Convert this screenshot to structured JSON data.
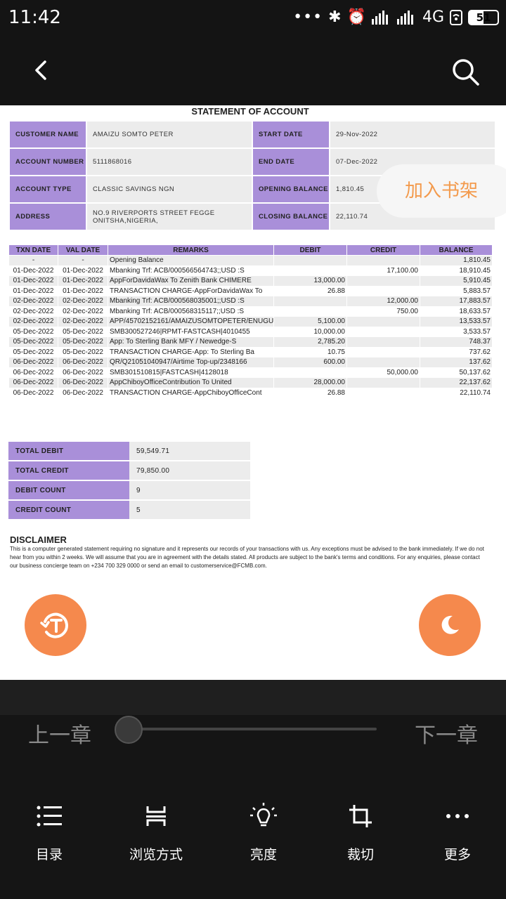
{
  "status_bar": {
    "time": "11:42",
    "network": "4G",
    "battery": "51",
    "icons": [
      "more-dots-icon",
      "bluetooth-icon",
      "alarm-icon",
      "signal-icon",
      "signal-icon",
      "wifi-hotspot-icon",
      "battery-icon"
    ]
  },
  "document": {
    "title": "STATEMENT OF ACCOUNT",
    "info": [
      {
        "l1": "CUSTOMER NAME",
        "v1": "AMAIZU SOMTO PETER",
        "l2": "START DATE",
        "v2": "29-Nov-2022"
      },
      {
        "l1": "ACCOUNT NUMBER",
        "v1": "5111868016",
        "l2": "END DATE",
        "v2": "07-Dec-2022"
      },
      {
        "l1": "ACCOUNT TYPE",
        "v1": "CLASSIC SAVINGS NGN",
        "l2": "OPENING BALANCE",
        "v2": "1,810.45"
      },
      {
        "l1": "ADDRESS",
        "v1": "NO.9 RIVERPORTS STREET FEGGE ONITSHA,NIGERIA,",
        "l2": "CLOSING BALANCE",
        "v2": "22,110.74"
      }
    ],
    "txn_headers": [
      "TXN DATE",
      "VAL DATE",
      "REMARKS",
      "DEBIT",
      "CREDIT",
      "BALANCE"
    ],
    "txn_rows": [
      [
        "-",
        "-",
        "Opening Balance",
        "",
        "",
        "1,810.45"
      ],
      [
        "01-Dec-2022",
        "01-Dec-2022",
        "Mbanking Trf: ACB/000566564743;;USD :S",
        "",
        "17,100.00",
        "18,910.45"
      ],
      [
        "01-Dec-2022",
        "01-Dec-2022",
        "AppForDavidaWax To Zenith Bank CHIMERE",
        "13,000.00",
        "",
        "5,910.45"
      ],
      [
        "01-Dec-2022",
        "01-Dec-2022",
        "TRANSACTION CHARGE-AppForDavidaWax To",
        "26.88",
        "",
        "5,883.57"
      ],
      [
        "02-Dec-2022",
        "02-Dec-2022",
        "Mbanking Trf: ACB/000568035001;;USD :S",
        "",
        "12,000.00",
        "17,883.57"
      ],
      [
        "02-Dec-2022",
        "02-Dec-2022",
        "Mbanking Trf: ACB/000568315117;;USD :S",
        "",
        "750.00",
        "18,633.57"
      ],
      [
        "02-Dec-2022",
        "02-Dec-2022",
        "APP/45702152161/AMAIZUSOMTOPETER/ENUGU",
        "5,100.00",
        "",
        "13,533.57"
      ],
      [
        "05-Dec-2022",
        "05-Dec-2022",
        "SMB300527246|RPMT-FASTCASH|4010455",
        "10,000.00",
        "",
        "3,533.57"
      ],
      [
        "05-Dec-2022",
        "05-Dec-2022",
        "App: To Sterling Bank MFY / Newedge-S",
        "2,785.20",
        "",
        "748.37"
      ],
      [
        "05-Dec-2022",
        "05-Dec-2022",
        "TRANSACTION CHARGE-App: To Sterling Ba",
        "10.75",
        "",
        "737.62"
      ],
      [
        "06-Dec-2022",
        "06-Dec-2022",
        "QR/Q21051040947/Airtime Top-up/2348166",
        "600.00",
        "",
        "137.62"
      ],
      [
        "06-Dec-2022",
        "06-Dec-2022",
        "SMB301510815|FASTCASH|4128018",
        "",
        "50,000.00",
        "50,137.62"
      ],
      [
        "06-Dec-2022",
        "06-Dec-2022",
        "AppChiboyOfficeContribution To United",
        "28,000.00",
        "",
        "22,137.62"
      ],
      [
        "06-Dec-2022",
        "06-Dec-2022",
        "TRANSACTION CHARGE-AppChiboyOfficeCont",
        "26.88",
        "",
        "22,110.74"
      ]
    ],
    "summary": [
      {
        "label": "TOTAL DEBIT",
        "value": "59,549.71"
      },
      {
        "label": "TOTAL CREDIT",
        "value": "79,850.00"
      },
      {
        "label": "DEBIT COUNT",
        "value": "9"
      },
      {
        "label": "CREDIT COUNT",
        "value": "5"
      }
    ],
    "disclaimer_title": "DISCLAIMER",
    "disclaimer_text": "This is a computer generated statement requiring no signature and it represents our records of your transactions with us. Any exceptions must be advised to the bank immediately. If we do not hear from you within 2 weeks. We will assume that you are in agreement with the details stated. All products are subject to the bank's terms and conditions. For any enquiries, please contact our business concierge team on +234 700 329 0000 or send an email to customerservice@FCMB.com."
  },
  "overlay": {
    "add_to_shelf": "加入书架"
  },
  "reader_panel": {
    "prev_chapter": "上一章",
    "next_chapter": "下一章",
    "progress": 0.0,
    "menu": [
      {
        "label": "目录",
        "icon": "list-icon"
      },
      {
        "label": "浏览方式",
        "icon": "view-mode-icon"
      },
      {
        "label": "亮度",
        "icon": "brightness-icon"
      },
      {
        "label": "裁切",
        "icon": "crop-icon"
      },
      {
        "label": "更多",
        "icon": "more-icon"
      }
    ]
  },
  "colors": {
    "header_purple": "#a98fd9",
    "accent_orange": "#f5894d",
    "row_gray": "#ececec"
  }
}
